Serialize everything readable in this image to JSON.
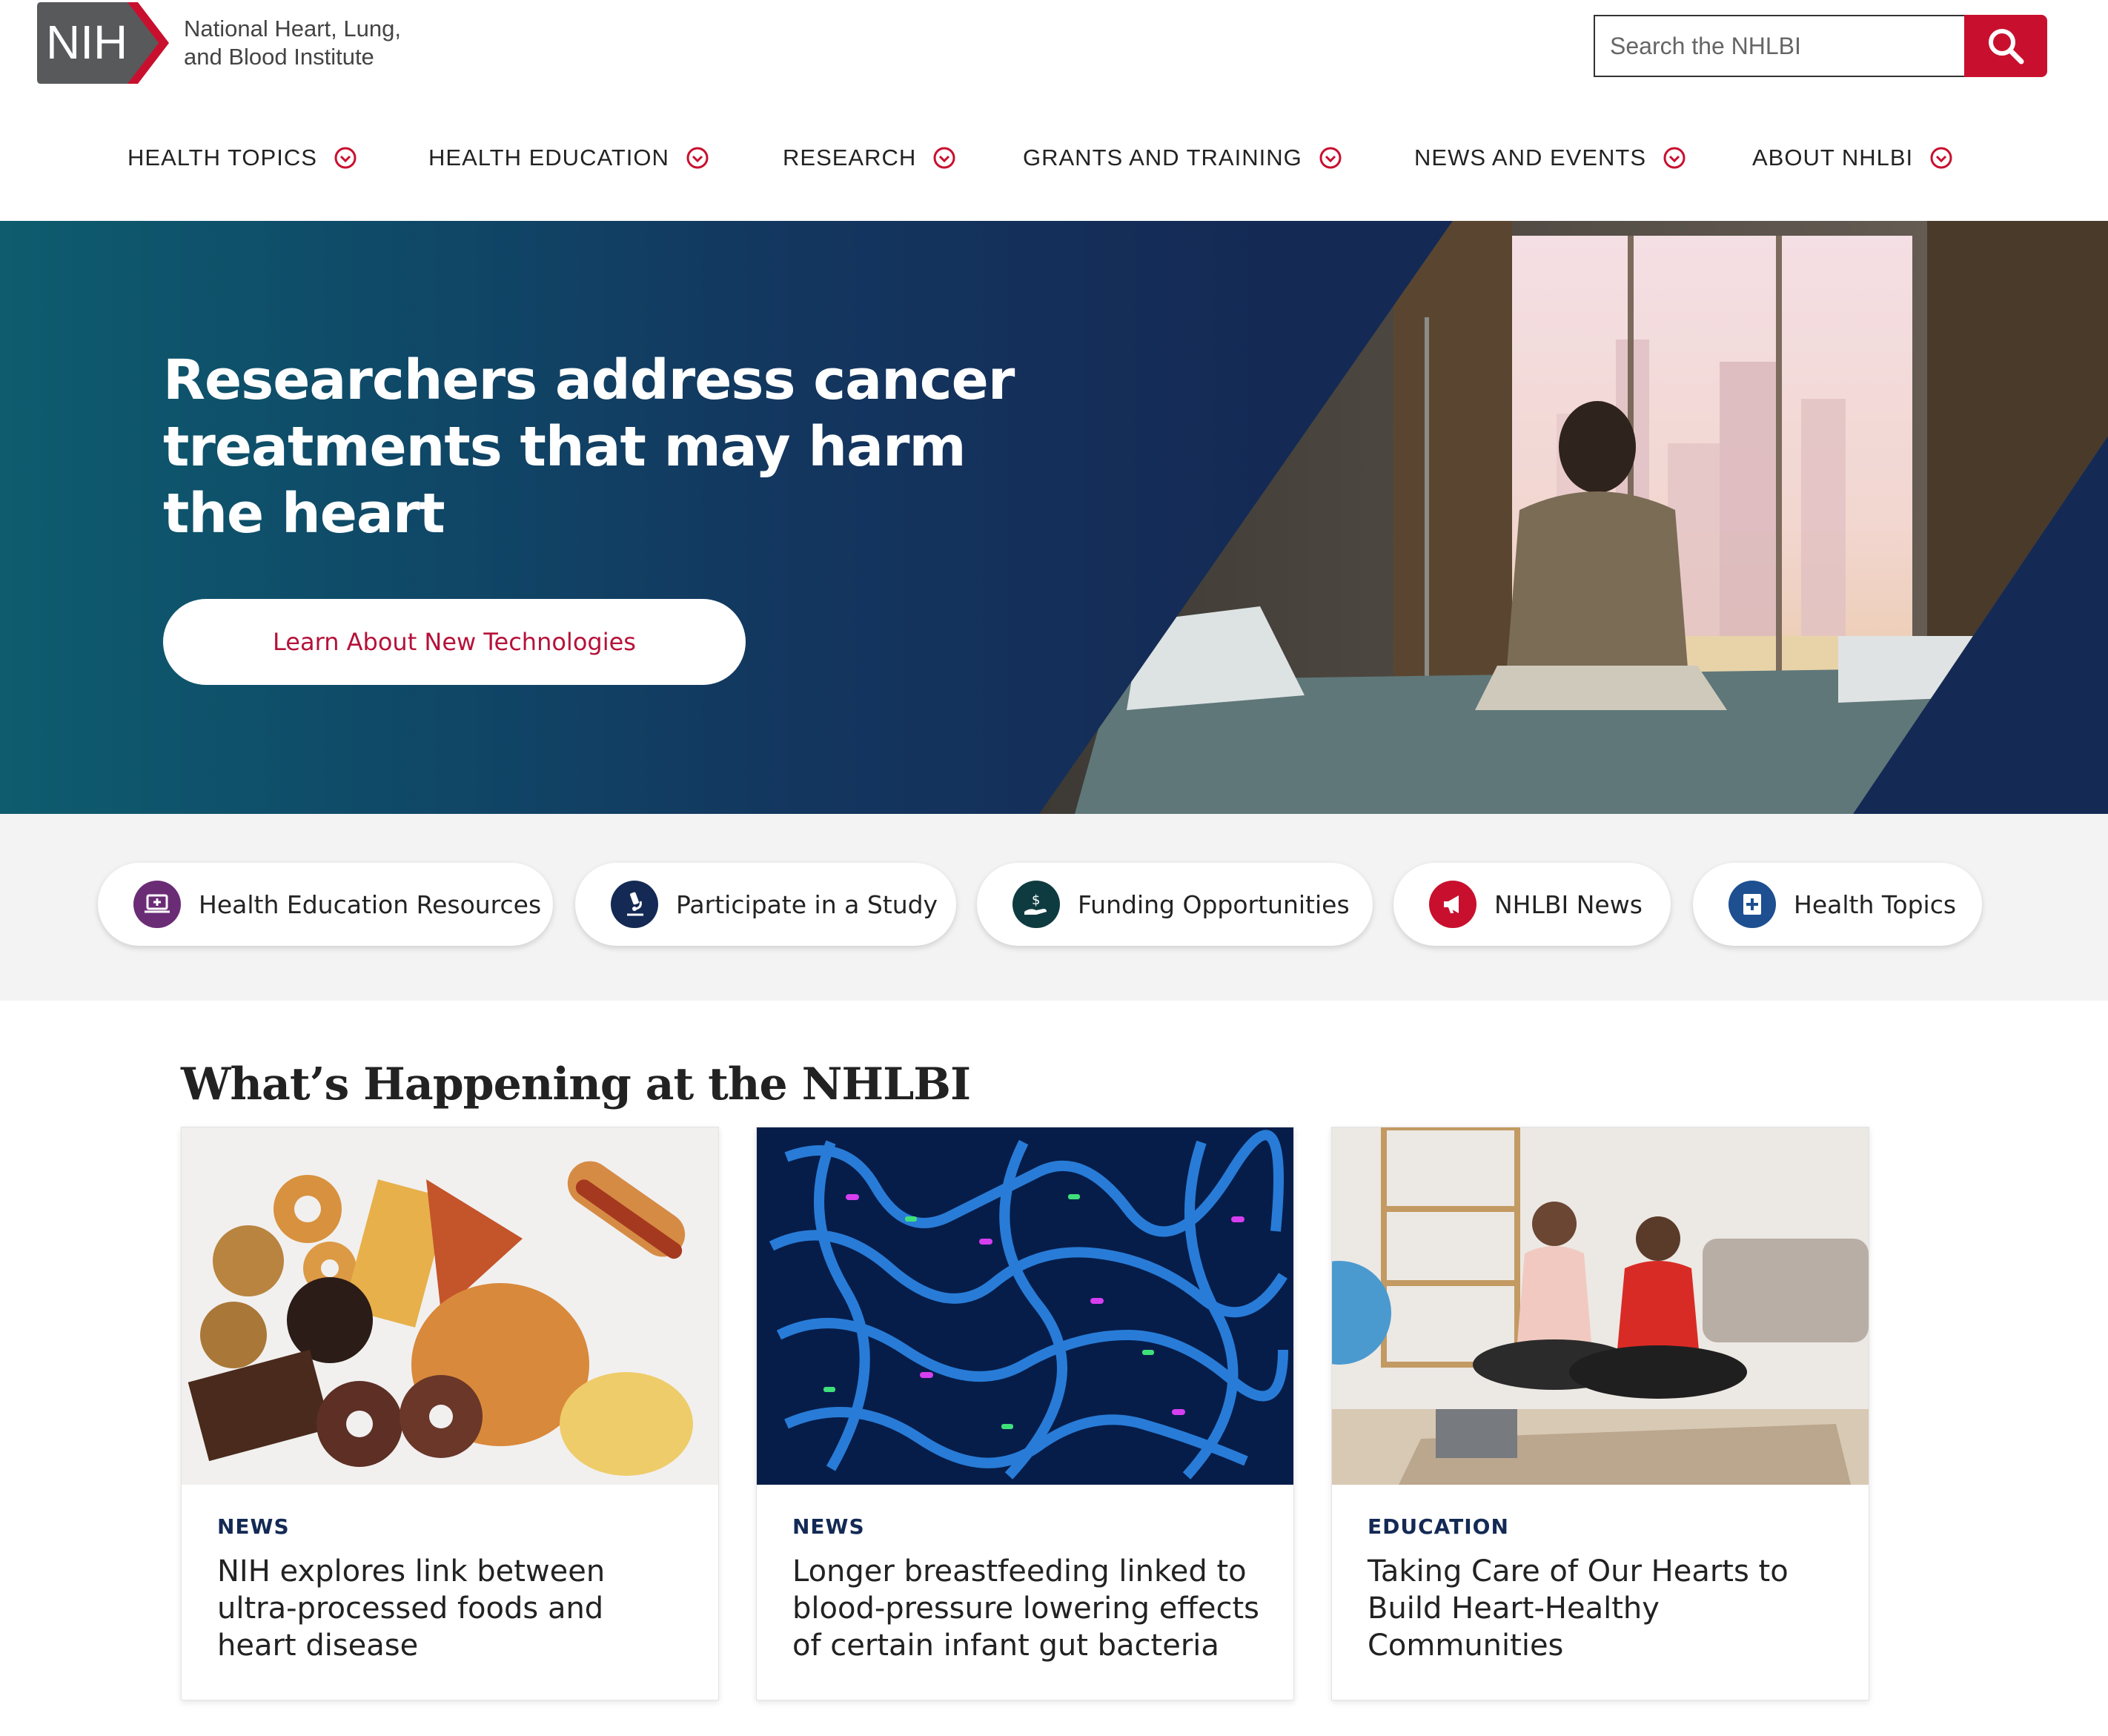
{
  "header": {
    "logo_abbrev": "NIH",
    "logo_line1": "National Heart, Lung,",
    "logo_line2": "and Blood Institute",
    "search_placeholder": "Search the NHLBI"
  },
  "nav": {
    "items": [
      {
        "label": "HEALTH TOPICS"
      },
      {
        "label": "HEALTH EDUCATION"
      },
      {
        "label": "RESEARCH"
      },
      {
        "label": "GRANTS AND TRAINING"
      },
      {
        "label": "NEWS AND EVENTS"
      },
      {
        "label": "ABOUT NHLBI"
      }
    ]
  },
  "hero": {
    "title": "Researchers address cancer treatments that may harm the heart",
    "button_label": "Learn About New Technologies"
  },
  "quick_links": [
    {
      "label": "Health Education Resources",
      "icon": "laptop-medical-icon",
      "color": "#6b2c76"
    },
    {
      "label": "Participate in a Study",
      "icon": "microscope-icon",
      "color": "#142a55"
    },
    {
      "label": "Funding Opportunities",
      "icon": "hand-dollar-icon",
      "color": "#0e3b40"
    },
    {
      "label": "NHLBI News",
      "icon": "megaphone-icon",
      "color": "#c8102e"
    },
    {
      "label": "Health Topics",
      "icon": "medical-book-icon",
      "color": "#1d4f91"
    }
  ],
  "section": {
    "title": "What’s Happening at the NHLBI"
  },
  "cards": [
    {
      "tag": "NEWS",
      "title": "NIH explores link between ultra-processed foods and heart disease"
    },
    {
      "tag": "NEWS",
      "title": "Longer breastfeeding linked to blood-pressure lowering effects of certain infant gut bacteria"
    },
    {
      "tag": "EDUCATION",
      "title": "Taking Care of Our Hearts to Build Heart-Healthy Communities"
    }
  ],
  "colors": {
    "brand_red": "#c8102e",
    "navy": "#142a55",
    "teal": "#0e5c6e"
  }
}
